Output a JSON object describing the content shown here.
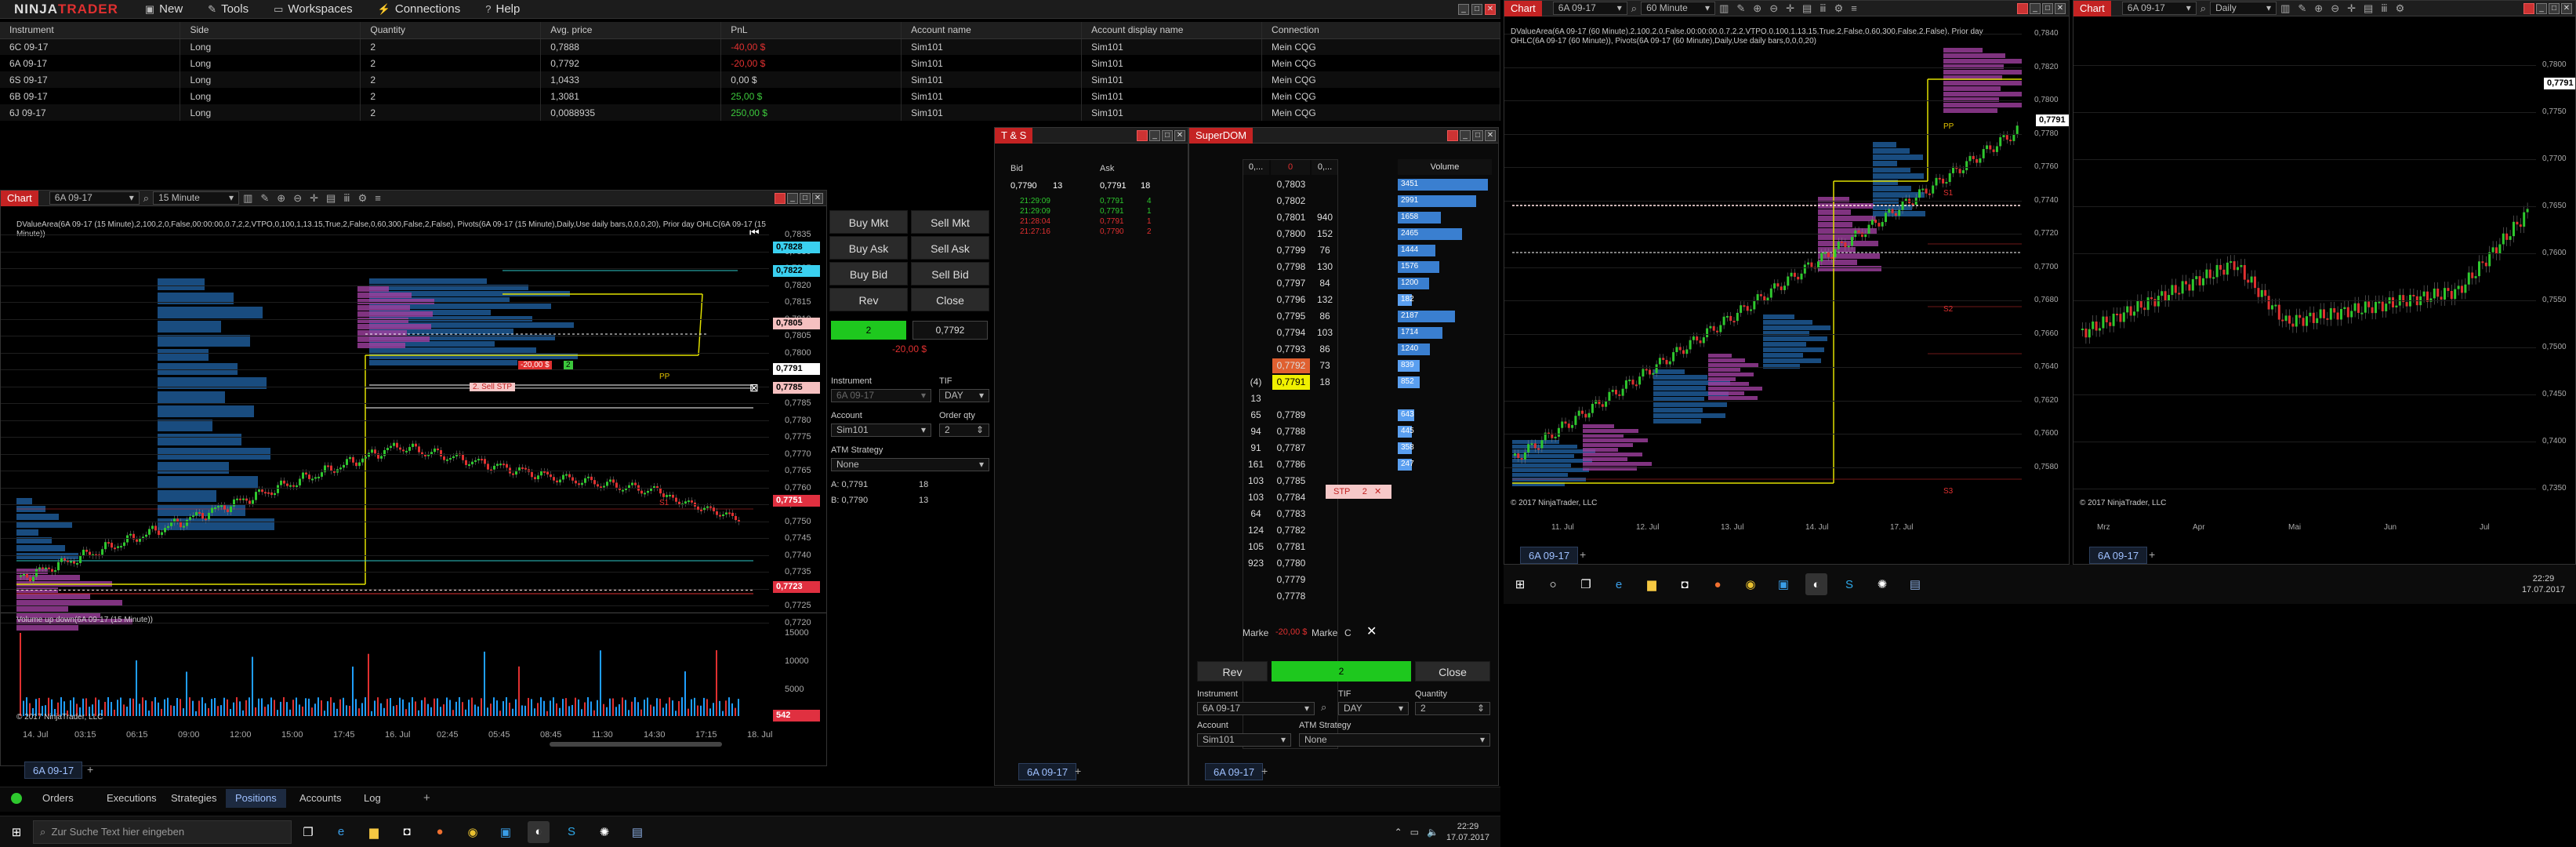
{
  "app": {
    "logo_ninja": "NINJA",
    "logo_trader": "TRADER"
  },
  "menu": [
    {
      "icon": "▣",
      "label": "New"
    },
    {
      "icon": "✎",
      "label": "Tools"
    },
    {
      "icon": "▭",
      "label": "Workspaces"
    },
    {
      "icon": "⚡",
      "label": "Connections"
    },
    {
      "icon": "?",
      "label": "Help"
    }
  ],
  "positions": {
    "headers": [
      "Instrument",
      "Side",
      "Quantity",
      "Avg. price",
      "PnL",
      "Account name",
      "Account display name",
      "Connection"
    ],
    "rows": [
      [
        "6C 09-17",
        "Long",
        "2",
        "0,7888",
        "-40,00 $",
        "Sim101",
        "Sim101",
        "Mein CQG"
      ],
      [
        "6A 09-17",
        "Long",
        "2",
        "0,7792",
        "-20,00 $",
        "Sim101",
        "Sim101",
        "Mein CQG"
      ],
      [
        "6S 09-17",
        "Long",
        "2",
        "1,0433",
        "0,00 $",
        "Sim101",
        "Sim101",
        "Mein CQG"
      ],
      [
        "6B 09-17",
        "Long",
        "2",
        "1,3081",
        "25,00 $",
        "Sim101",
        "Sim101",
        "Mein CQG"
      ],
      [
        "6J 09-17",
        "Long",
        "2",
        "0,0088935",
        "250,00 $",
        "Sim101",
        "Sim101",
        "Mein CQG"
      ]
    ]
  },
  "chart1": {
    "title": "Chart",
    "instrument": "6A 09-17",
    "interval": "15 Minute",
    "indicator_text": "DValueArea(6A 09-17 (15 Minute),2,100,2,0,False,00:00:00,0.7,2,2,VTPO,0,100,1,13.15,True,2,False,0,60,300,False,2,False), Pivots(6A 09-17 (15 Minute),Daily,Use daily bars,0,0,0,20), Prior day OHLC(6A 09-17 (15 Minute))",
    "volume_label": "Volume up down(6A 09-17 (15 Minute))",
    "copyright": "© 2017 NinjaTrader, LLC",
    "price_ticks": [
      "0,7835",
      "0,7830",
      "0,7825",
      "0,7820",
      "0,7815",
      "0,7810",
      "0,7805",
      "0,7800",
      "0,7795",
      "0,7790",
      "0,7785",
      "0,7780",
      "0,7775",
      "0,7770",
      "0,7765",
      "0,7760",
      "0,7755",
      "0,7750",
      "0,7745",
      "0,7740",
      "0,7735",
      "0,7730",
      "0,7725",
      "0,7720"
    ],
    "vol_ticks": [
      "15000",
      "10000",
      "5000",
      "0"
    ],
    "time_ticks": [
      "14. Jul",
      "03:15",
      "06:15",
      "09:00",
      "12:00",
      "15:00",
      "17:45",
      "16. Jul",
      "02:45",
      "05:45",
      "08:45",
      "11:30",
      "14:30",
      "17:15",
      "18. Jul"
    ],
    "tags": {
      "p1": "0,7828",
      "p2": "0,7822",
      "p3": "0,7805",
      "p4": "0,7791",
      "p5": "0,7785",
      "p6": "0,7751",
      "p7": "0,7723",
      "vol": "542"
    },
    "order_pnl": "-20,00 $",
    "order_qty": "2",
    "sell_stp": "2. Sell STP",
    "pp": "PP",
    "s1": "S1",
    "tab": "6A 09-17"
  },
  "chart_trader": {
    "buy_mkt": "Buy Mkt",
    "sell_mkt": "Sell Mkt",
    "buy_ask": "Buy Ask",
    "sell_ask": "Sell Ask",
    "buy_bid": "Buy Bid",
    "sell_bid": "Sell Bid",
    "rev": "Rev",
    "close": "Close",
    "qty": "2",
    "avg": "0,7792",
    "pnl": "-20,00 $",
    "instrument_label": "Instrument",
    "instrument": "6A 09-17",
    "tif_label": "TIF",
    "tif": "DAY",
    "account_label": "Account",
    "account": "Sim101",
    "orderqty_label": "Order qty",
    "orderqty": "2",
    "atm_label": "ATM Strategy",
    "atm": "None",
    "ask_line": "A: 0,7791",
    "ask_size": "18",
    "bid_line": "B: 0,7790",
    "bid_size": "13"
  },
  "ts": {
    "title": "T & S",
    "bid_h": "Bid",
    "ask_h": "Ask",
    "bid": "0,7790",
    "bid_sz": "13",
    "ask": "0,7791",
    "ask_sz": "18",
    "rows": [
      [
        "21:29:09",
        "0,7791",
        "4"
      ],
      [
        "21:29:09",
        "0,7791",
        "1"
      ],
      [
        "21:28:04",
        "0,7791",
        "1"
      ],
      [
        "21:27:16",
        "0,7790",
        "2"
      ]
    ],
    "tab": "6A 09-17"
  },
  "dom": {
    "title": "SuperDOM",
    "h1": "0,...",
    "h2": "0",
    "h3": "0,...",
    "vol_h": "Volume",
    "rows": [
      [
        "",
        "0,7803",
        "",
        "3451"
      ],
      [
        "",
        "0,7802",
        "",
        "2991"
      ],
      [
        "",
        "0,7801",
        "940",
        "1658"
      ],
      [
        "",
        "0,7800",
        "152",
        "2465"
      ],
      [
        "",
        "0,7799",
        "76",
        "1444"
      ],
      [
        "",
        "0,7798",
        "130",
        "1576"
      ],
      [
        "",
        "0,7797",
        "84",
        "1200"
      ],
      [
        "",
        "0,7796",
        "132",
        "182"
      ],
      [
        "",
        "0,7795",
        "86",
        "2187"
      ],
      [
        "",
        "0,7794",
        "103",
        "1714"
      ],
      [
        "",
        "0,7793",
        "86",
        "1240"
      ],
      [
        "",
        "0,7792",
        "73",
        "839"
      ],
      [
        "(4)",
        "0,7791",
        "18",
        "852"
      ],
      [
        "13",
        "",
        "",
        ""
      ],
      [
        "65",
        "0,7789",
        "",
        "643"
      ],
      [
        "94",
        "0,7788",
        "",
        "445"
      ],
      [
        "91",
        "0,7787",
        "",
        "358"
      ],
      [
        "161",
        "0,7786",
        "",
        "247"
      ],
      [
        "103",
        "0,7785",
        "",
        ""
      ],
      [
        "103",
        "0,7784",
        "",
        ""
      ],
      [
        "64",
        "0,7783",
        "",
        ""
      ],
      [
        "124",
        "0,7782",
        "",
        ""
      ],
      [
        "105",
        "0,7781",
        "",
        ""
      ],
      [
        "923",
        "0,7780",
        "",
        ""
      ],
      [
        "",
        "0,7779",
        "",
        ""
      ],
      [
        "",
        "0,7778",
        "",
        ""
      ]
    ],
    "stp": "STP",
    "stp_qty": "2",
    "mkt_l": "Marke",
    "mkt_pnl": "-20,00 $",
    "mkt_r": "Marke",
    "mkt_c": "C",
    "rev": "Rev",
    "qty": "2",
    "close": "Close",
    "instrument_label": "Instrument",
    "instrument": "6A 09-17",
    "tif_label": "TIF",
    "tif": "DAY",
    "qty_label": "Quantity",
    "qtyv": "2",
    "account_label": "Account",
    "account": "Sim101",
    "atm_label": "ATM Strategy",
    "atm": "None",
    "tab": "6A 09-17"
  },
  "chart2": {
    "title": "Chart",
    "instrument": "6A 09-17",
    "interval": "60 Minute",
    "indicator_text": "DValueArea(6A 09-17 (60 Minute),2,100,2,0,False,00:00:00,0.7,2,2,VTPO,0,100,1,13.15,True,2,False,0,60,300,False,2,False), Prior day OHLC(6A 09-17 (60 Minute)), Pivots(6A 09-17 (60 Minute),Daily,Use daily bars,0,0,0,20)",
    "price_ticks": [
      "0,7840",
      "0,7820",
      "0,7800",
      "0,7780",
      "0,7760",
      "0,7740",
      "0,7720",
      "0,7700",
      "0,7680",
      "0,7660",
      "0,7640",
      "0,7620",
      "0,7600",
      "0,7580"
    ],
    "time_ticks": [
      "11. Jul",
      "12. Jul",
      "13. Jul",
      "14. Jul",
      "17. Jul"
    ],
    "tag": "0,7791",
    "pp": "PP",
    "r1": "R1",
    "s1": "S1",
    "s2": "S2",
    "s3": "S3",
    "copyright": "© 2017 NinjaTrader, LLC",
    "tab": "6A 09-17"
  },
  "chart3": {
    "title": "Chart",
    "instrument": "6A 09-17",
    "interval": "Daily",
    "price_ticks": [
      "0,7800",
      "0,7750",
      "0,7700",
      "0,7650",
      "0,7600",
      "0,7550",
      "0,7500",
      "0,7450",
      "0,7400",
      "0,7350"
    ],
    "time_ticks": [
      "Mrz",
      "Apr",
      "Mai",
      "Jun",
      "Jul"
    ],
    "tag": "0,7791",
    "copyright": "© 2017 NinjaTrader, LLC",
    "tab": "6A 09-17"
  },
  "bottom_tabs": [
    "Orders",
    "Executions",
    "Strategies",
    "Positions",
    "Accounts",
    "Log"
  ],
  "taskbar": {
    "search": "Zur Suche Text hier eingeben",
    "time": "22:29",
    "date": "17.07.2017"
  },
  "taskbar2": {
    "time": "22:29",
    "date": "17.07.2017"
  }
}
